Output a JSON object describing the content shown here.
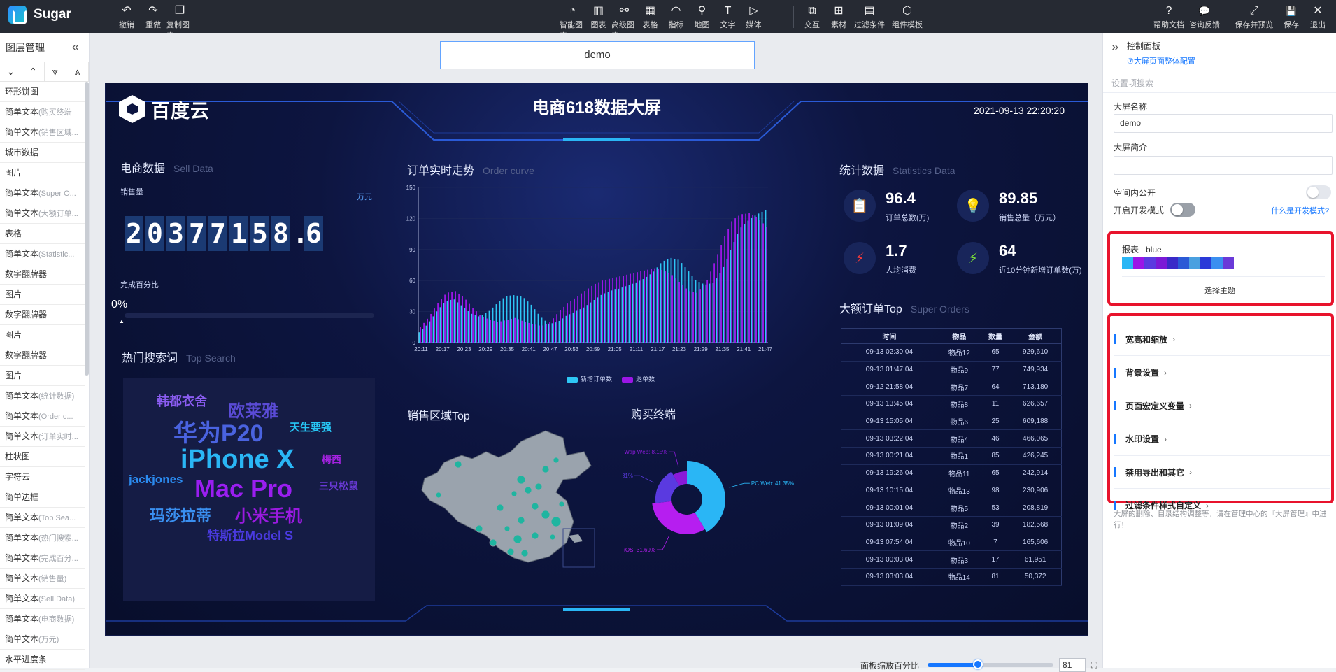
{
  "app": {
    "name": "Sugar"
  },
  "toolbar": {
    "left": [
      {
        "label": "撤销",
        "icon": "undo-icon",
        "glyph": "↶"
      },
      {
        "label": "重做",
        "icon": "redo-icon",
        "glyph": "↷"
      },
      {
        "label": "复制图表",
        "icon": "copy-icon",
        "glyph": "❐"
      }
    ],
    "center": [
      {
        "label": "智能图表",
        "icon": "smart-chart-icon",
        "glyph": "◔"
      },
      {
        "label": "图表",
        "icon": "bar-chart-icon",
        "glyph": "▥"
      },
      {
        "label": "高级图表",
        "icon": "advanced-chart-icon",
        "glyph": "⚯"
      },
      {
        "label": "表格",
        "icon": "table-icon",
        "glyph": "▦"
      },
      {
        "label": "指标",
        "icon": "gauge-icon",
        "glyph": "◠"
      },
      {
        "label": "地图",
        "icon": "map-pin-icon",
        "glyph": "⚲"
      },
      {
        "label": "文字",
        "icon": "text-icon",
        "glyph": "T"
      },
      {
        "label": "媒体",
        "icon": "media-icon",
        "glyph": "▷"
      }
    ],
    "center2": [
      {
        "label": "交互",
        "icon": "interaction-icon",
        "glyph": "⧉"
      },
      {
        "label": "素材",
        "icon": "assets-icon",
        "glyph": "⊞"
      },
      {
        "label": "过滤条件",
        "icon": "filter-icon",
        "glyph": "▤"
      },
      {
        "label": "组件模板",
        "icon": "template-icon",
        "glyph": "⬡"
      }
    ],
    "right": [
      {
        "label": "帮助文档",
        "icon": "help-icon",
        "glyph": "?"
      },
      {
        "label": "咨询反馈",
        "icon": "feedback-icon",
        "glyph": "💬"
      },
      {
        "label": "保存并预览",
        "icon": "expand-icon",
        "glyph": "⤢"
      },
      {
        "label": "保存",
        "icon": "save-icon",
        "glyph": "💾"
      },
      {
        "label": "退出",
        "icon": "close-icon",
        "glyph": "✕"
      }
    ]
  },
  "layers": {
    "title": "图层管理",
    "tools": [
      "⌄",
      "⌃",
      "⩔",
      "⩓"
    ],
    "items": [
      {
        "name": "环形饼图",
        "sub": ""
      },
      {
        "name": "简单文本",
        "sub": "(购买终端"
      },
      {
        "name": "简单文本",
        "sub": "(销售区域..."
      },
      {
        "name": "城市数据",
        "sub": ""
      },
      {
        "name": "图片",
        "sub": ""
      },
      {
        "name": "简单文本",
        "sub": "(Super O..."
      },
      {
        "name": "简单文本",
        "sub": "(大额订单..."
      },
      {
        "name": "表格",
        "sub": ""
      },
      {
        "name": "简单文本",
        "sub": "(Statistic..."
      },
      {
        "name": "数字翻牌器",
        "sub": ""
      },
      {
        "name": "图片",
        "sub": ""
      },
      {
        "name": "数字翻牌器",
        "sub": ""
      },
      {
        "name": "图片",
        "sub": ""
      },
      {
        "name": "数字翻牌器",
        "sub": ""
      },
      {
        "name": "图片",
        "sub": ""
      },
      {
        "name": "简单文本",
        "sub": "(统计数据)"
      },
      {
        "name": "简单文本",
        "sub": "(Order c..."
      },
      {
        "name": "简单文本",
        "sub": "(订单实时..."
      },
      {
        "name": "柱状图",
        "sub": ""
      },
      {
        "name": "字符云",
        "sub": ""
      },
      {
        "name": "简单边框",
        "sub": ""
      },
      {
        "name": "简单文本",
        "sub": "(Top Sea..."
      },
      {
        "name": "简单文本",
        "sub": "(热门搜索..."
      },
      {
        "name": "简单文本",
        "sub": "(完成百分..."
      },
      {
        "name": "简单文本",
        "sub": "(销售量)"
      },
      {
        "name": "简单文本",
        "sub": "(Sell Data)"
      },
      {
        "name": "简单文本",
        "sub": "(电商数据)"
      },
      {
        "name": "简单文本",
        "sub": "(万元)"
      },
      {
        "name": "水平进度条",
        "sub": ""
      }
    ]
  },
  "editor": {
    "screen_name": "demo",
    "zoom_label": "面板缩放百分比",
    "zoom_value": "81",
    "zoom_level": 0.4
  },
  "dashboard": {
    "brand": "百度云",
    "title": "电商618数据大屏",
    "datetime": "2021-09-13 22:20:20",
    "sell": {
      "title": "电商数据",
      "title_en": "Sell Data",
      "label": "销售量",
      "unit": "万元",
      "digits": [
        "2",
        "0",
        "3",
        "7",
        "7",
        "1",
        "5",
        "8",
        ".",
        "6"
      ],
      "percent_label": "完成百分比",
      "percent": "0%"
    },
    "search": {
      "title": "热门搜索词",
      "title_en": "Top Search",
      "words": [
        {
          "text": "韩都衣舍",
          "color": "#8a5cf0"
        },
        {
          "text": "欧莱雅",
          "color": "#5a4bd6"
        },
        {
          "text": "华为P20",
          "color": "#4a63e0"
        },
        {
          "text": "天生要强",
          "color": "#27c6f5"
        },
        {
          "text": "iPhone X",
          "color": "#2ab6f5"
        },
        {
          "text": "梅西",
          "color": "#a422e0"
        },
        {
          "text": "jackjones",
          "color": "#2b8bf0"
        },
        {
          "text": "Mac Pro",
          "color": "#9a1ef0"
        },
        {
          "text": "三只松鼠",
          "color": "#6a3ad8"
        },
        {
          "text": "玛莎拉蒂",
          "color": "#3a8ff0"
        },
        {
          "text": "小米手机",
          "color": "#9a1ae0"
        },
        {
          "text": "特斯拉Model S",
          "color": "#4a3ae0"
        }
      ]
    },
    "order": {
      "title": "订单实时走势",
      "title_en": "Order curve",
      "legend": [
        "新增订单数",
        "退单数"
      ]
    },
    "region": {
      "title": "销售区域Top"
    },
    "terminal": {
      "title": "购买终端"
    },
    "stats": {
      "title": "统计数据",
      "title_en": "Statistics Data",
      "items": [
        {
          "value": "96.4",
          "label": "订单总数(万)",
          "icon": "clipboard-icon",
          "glyph": "📋",
          "color": "#7b6cf6"
        },
        {
          "value": "89.85",
          "label": "销售总量（万元）",
          "icon": "bulb-icon",
          "glyph": "💡",
          "color": "#f0a020"
        },
        {
          "value": "1.7",
          "label": "人均消费",
          "icon": "lightning-red-icon",
          "glyph": "⚡",
          "color": "#f03a3a"
        },
        {
          "value": "64",
          "label": "近10分钟新增订单数(万)",
          "icon": "lightning-green-icon",
          "glyph": "⚡",
          "color": "#7be03a"
        }
      ]
    },
    "orders_top": {
      "title": "大额订单Top",
      "title_en": "Super Orders",
      "columns": [
        "时间",
        "物品",
        "数量",
        "金额"
      ],
      "rows": [
        [
          "09-13 02:30:04",
          "物品12",
          "65",
          "929,610"
        ],
        [
          "09-13 01:47:04",
          "物品9",
          "77",
          "749,934"
        ],
        [
          "09-12 21:58:04",
          "物品7",
          "64",
          "713,180"
        ],
        [
          "09-13 13:45:04",
          "物品8",
          "11",
          "626,657"
        ],
        [
          "09-13 15:05:04",
          "物品6",
          "25",
          "609,188"
        ],
        [
          "09-13 03:22:04",
          "物品4",
          "46",
          "466,065"
        ],
        [
          "09-13 00:21:04",
          "物品1",
          "85",
          "426,245"
        ],
        [
          "09-13 19:26:04",
          "物品11",
          "65",
          "242,914"
        ],
        [
          "09-13 10:15:04",
          "物品13",
          "98",
          "230,906"
        ],
        [
          "09-13 00:01:04",
          "物品5",
          "53",
          "208,819"
        ],
        [
          "09-13 01:09:04",
          "物品2",
          "39",
          "182,568"
        ],
        [
          "09-13 07:54:04",
          "物品10",
          "7",
          "165,606"
        ],
        [
          "09-13 00:03:04",
          "物品3",
          "17",
          "61,951"
        ],
        [
          "09-13 03:03:04",
          "物品14",
          "81",
          "50,372"
        ]
      ]
    }
  },
  "chart_data": [
    {
      "type": "bar",
      "title": "订单实时走势",
      "ylim": [
        0,
        150
      ],
      "yticks": [
        0,
        30,
        60,
        90,
        120,
        150
      ],
      "xticks": [
        "20:11",
        "20:17",
        "20:23",
        "20:29",
        "20:35",
        "20:41",
        "20:47",
        "20:53",
        "20:59",
        "21:05",
        "21:11",
        "21:17",
        "21:23",
        "21:29",
        "21:35",
        "21:41",
        "21:47"
      ],
      "series": [
        {
          "name": "新增订单数",
          "color": "#2ec7f5",
          "anchors": [
            10,
            18,
            30,
            40,
            42,
            35,
            28,
            25,
            30,
            38,
            45,
            46,
            44,
            36,
            25,
            18,
            20,
            26,
            30,
            34,
            40,
            46,
            50,
            52,
            55,
            58,
            62,
            68,
            78,
            82,
            80,
            70,
            60,
            56,
            58,
            70,
            90,
            110,
            118,
            124,
            128
          ]
        },
        {
          "name": "退单数",
          "color": "#9b16e6",
          "anchors": [
            15,
            25,
            38,
            48,
            50,
            44,
            34,
            26,
            22,
            20,
            22,
            24,
            20,
            18,
            16,
            20,
            30,
            38,
            44,
            50,
            56,
            60,
            62,
            64,
            66,
            68,
            70,
            72,
            70,
            66,
            58,
            50,
            48,
            58,
            78,
            100,
            118,
            124,
            125,
            120,
            112
          ]
        }
      ]
    },
    {
      "type": "pie",
      "title": "购买终端",
      "slices": [
        {
          "name": "PC Web",
          "value": 41.35,
          "color": "#2ab6f5"
        },
        {
          "name": "iOS",
          "value": 31.69,
          "color": "#b61ef0"
        },
        {
          "name": "Android",
          "value": 18.81,
          "color": "#5a3ae0"
        },
        {
          "name": "Wap Web",
          "value": 8.15,
          "color": "#8a1ad8"
        }
      ]
    }
  ],
  "panel": {
    "title": "控制面板",
    "subtitle": "⑦大屏页面整体配置",
    "search_placeholder": "设置项搜索",
    "name_label": "大屏名称",
    "name_value": "demo",
    "intro_label": "大屏简介",
    "intro_value": "",
    "public_label": "空间内公开",
    "dev_label": "开启开发模式",
    "dev_link": "什么是开发模式?",
    "theme_label": "报表",
    "theme_name": "blue",
    "theme_colors": [
      "#2ab6f5",
      "#9b16e6",
      "#5a3ae0",
      "#7b1ad6",
      "#3a2ac8",
      "#2b5ad6",
      "#4aa0e0",
      "#2a3ad8",
      "#3a8ff0",
      "#6a3ad8"
    ],
    "theme_button": "选择主题",
    "sections": [
      "宽高和缩放",
      "背景设置",
      "页面宏定义变量",
      "水印设置",
      "禁用导出和其它",
      "过滤条件样式自定义"
    ],
    "note": "大屏的删除、目录结构调整等，请在管理中心的『大屏管理』中进行！"
  }
}
